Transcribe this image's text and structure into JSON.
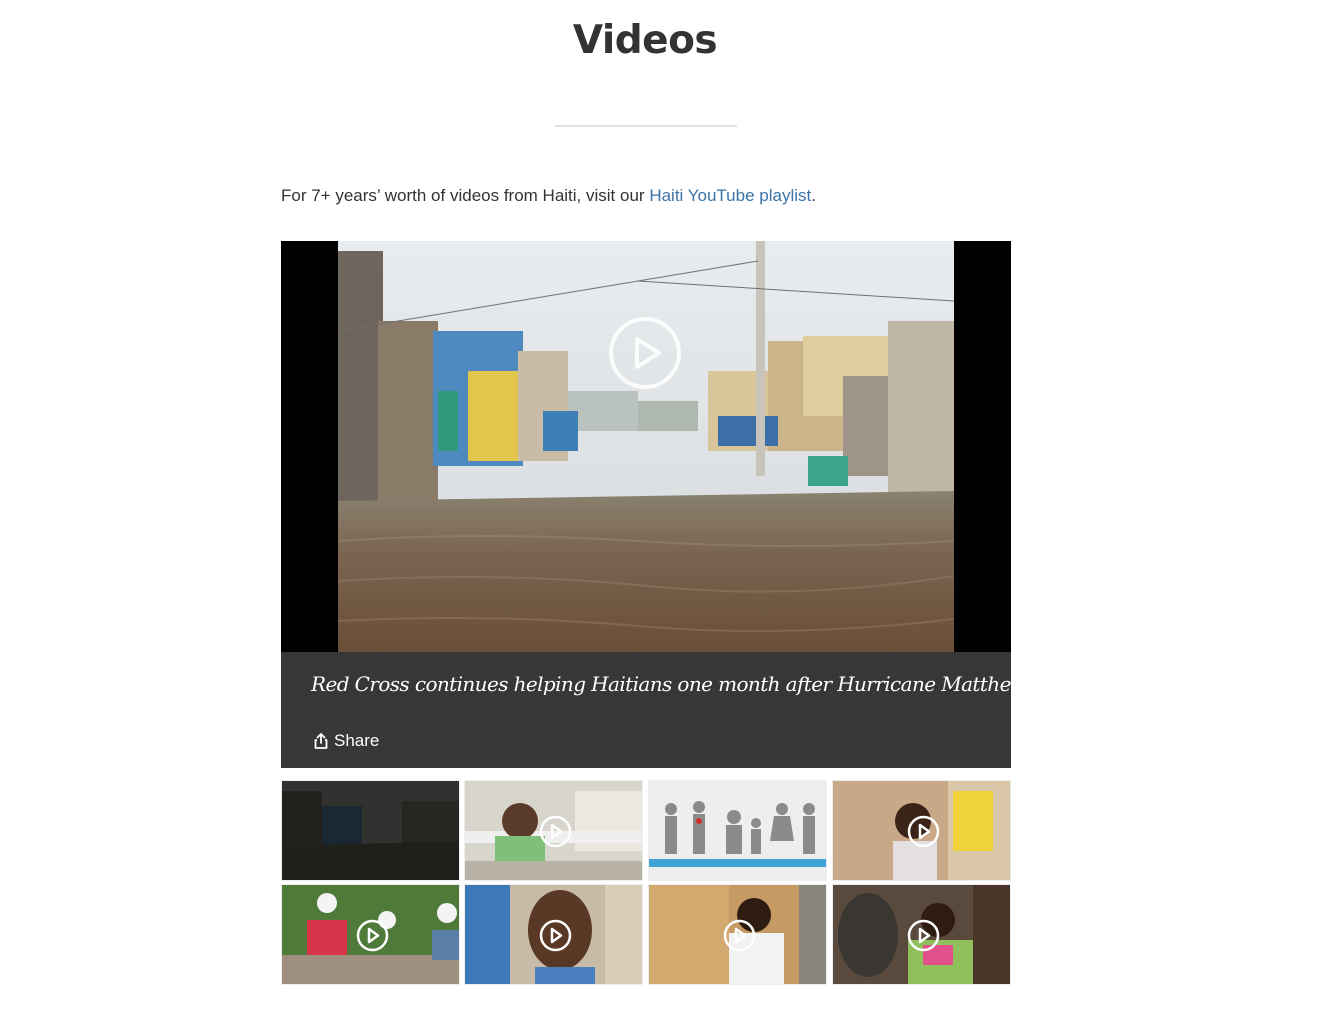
{
  "page": {
    "title": "Videos"
  },
  "intro": {
    "text_before": "For 7+ years’ worth of videos from Haiti, visit our ",
    "link_text": "Haiti YouTube playlist",
    "text_after": "."
  },
  "player": {
    "title": "Red Cross continues helping Haitians one month after Hurricane Matthew’s landfall",
    "share_label": "Share"
  },
  "thumbnails": [
    {
      "scene": "flooded-street",
      "active": true
    },
    {
      "scene": "girl-on-balcony",
      "active": false
    },
    {
      "scene": "infographic-people",
      "active": false
    },
    {
      "scene": "child-standing",
      "active": false
    },
    {
      "scene": "workers-hard-hats",
      "active": false
    },
    {
      "scene": "smiling-woman",
      "active": false
    },
    {
      "scene": "man-by-wooden-door",
      "active": false
    },
    {
      "scene": "man-with-carved-masks",
      "active": false
    }
  ],
  "colors": {
    "link": "#3b73a8",
    "caption_bar": "#373737",
    "title_text": "#333333"
  },
  "icons": {
    "play": "play-icon",
    "share": "share-icon"
  }
}
